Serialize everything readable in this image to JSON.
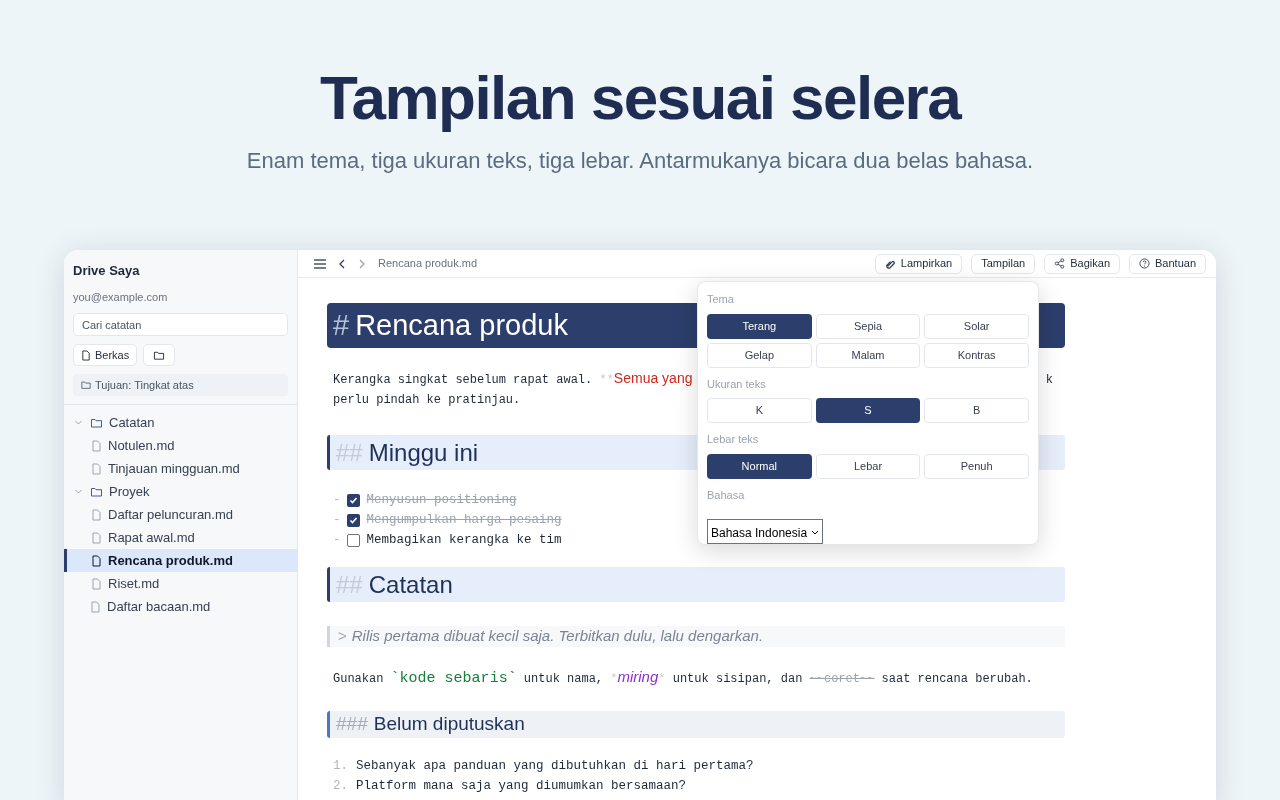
{
  "hero": {
    "title": "Tampilan sesuai selera",
    "subtitle": "Enam tema, tiga ukuran teks, tiga lebar. Antarmukanya bicara dua belas bahasa."
  },
  "sidebar": {
    "title": "Drive Saya",
    "email": "you@example.com",
    "search": {
      "placeholder": "Cari catatan"
    },
    "buttons": [
      {
        "kind": "file",
        "label": "Berkas"
      },
      {
        "kind": "folder"
      }
    ],
    "destination": "Tujuan: Tingkat atas",
    "tree": [
      {
        "kind": "folder",
        "label": "Catatan",
        "expanded": true,
        "selected": false,
        "children": [
          {
            "kind": "file",
            "label": "Notulen.md",
            "selected": false
          },
          {
            "kind": "file",
            "label": "Tinjauan mingguan.md",
            "selected": false
          }
        ]
      },
      {
        "kind": "folder",
        "label": "Proyek",
        "expanded": true,
        "selected": false,
        "children": [
          {
            "kind": "file",
            "label": "Daftar peluncuran.md",
            "selected": false
          },
          {
            "kind": "file",
            "label": "Rapat awal.md",
            "selected": false
          },
          {
            "kind": "file",
            "label": "Rencana produk.md",
            "selected": true
          },
          {
            "kind": "file",
            "label": "Riset.md",
            "selected": false
          }
        ]
      },
      {
        "kind": "file",
        "label": "Daftar bacaan.md",
        "selected": false
      }
    ]
  },
  "toolbar": {
    "path": "Rencana produk.md",
    "buttons": [
      {
        "kind": "attach",
        "label": "Lampirkan"
      },
      {
        "kind": "plain",
        "label": "Tampilan"
      },
      {
        "kind": "share",
        "label": "Bagikan"
      },
      {
        "kind": "help",
        "label": "Bantuan"
      }
    ]
  },
  "editor": {
    "blocks": [
      {
        "kind": "h1",
        "marker": "#",
        "text": "Rencana produk"
      },
      {
        "kind": "paragraph",
        "lines": [
          {
            "segments": [
              {
                "kind": "text",
                "text": "Kerangka singkat sebelum rapat awal. "
              },
              {
                "kind": "mark",
                "text": "**"
              },
              {
                "kind": "strong",
                "text": "Semua yang"
              }
            ],
            "tail": "k"
          },
          {
            "segments": [
              {
                "kind": "text",
                "text": "perlu pindah ke pratinjau."
              }
            ]
          }
        ]
      },
      {
        "kind": "h2",
        "marker": "##",
        "text": "Minggu ini"
      },
      {
        "kind": "task",
        "marker": "-",
        "checked": true,
        "text": "Menyusun positioning"
      },
      {
        "kind": "task",
        "marker": "-",
        "checked": true,
        "text": "Mengumpulkan harga pesaing"
      },
      {
        "kind": "task",
        "marker": "-",
        "checked": false,
        "text": "Membagikan kerangka ke tim"
      },
      {
        "kind": "h2",
        "marker": "##",
        "text": "Catatan"
      },
      {
        "kind": "quote",
        "marker": ">",
        "text": "Rilis pertama dibuat kecil saja. Terbitkan dulu, lalu dengarkan."
      },
      {
        "kind": "paragraph",
        "lines": [
          {
            "segments": [
              {
                "kind": "text",
                "text": "Gunakan "
              },
              {
                "kind": "code",
                "text": "`kode sebaris`"
              },
              {
                "kind": "text",
                "text": " untuk nama, "
              },
              {
                "kind": "mark",
                "text": "*"
              },
              {
                "kind": "italic",
                "text": "miring"
              },
              {
                "kind": "mark",
                "text": "*"
              },
              {
                "kind": "text",
                "text": " untuk sisipan, dan "
              },
              {
                "kind": "strike",
                "text": "~~coret~~"
              },
              {
                "kind": "text",
                "text": " saat rencana berubah."
              }
            ]
          }
        ]
      },
      {
        "kind": "h3",
        "marker": "###",
        "text": "Belum diputuskan"
      },
      {
        "kind": "ordered",
        "items": [
          {
            "number": "1.",
            "text": "Sebanyak apa panduan yang dibutuhkan di hari pertama?"
          },
          {
            "number": "2.",
            "text": "Platform mana saja yang diumumkan bersamaan?"
          }
        ]
      }
    ]
  },
  "popover": {
    "sections": [
      {
        "label": "Tema",
        "options": [
          {
            "label": "Terang",
            "selected": true
          },
          {
            "label": "Sepia",
            "selected": false
          },
          {
            "label": "Solar",
            "selected": false
          },
          {
            "label": "Gelap",
            "selected": false
          },
          {
            "label": "Malam",
            "selected": false
          },
          {
            "label": "Kontras",
            "selected": false
          }
        ]
      },
      {
        "label": "Ukuran teks",
        "options": [
          {
            "label": "K",
            "selected": false
          },
          {
            "label": "S",
            "selected": true
          },
          {
            "label": "B",
            "selected": false
          }
        ]
      },
      {
        "label": "Lebar teks",
        "options": [
          {
            "label": "Normal",
            "selected": true
          },
          {
            "label": "Lebar",
            "selected": false
          },
          {
            "label": "Penuh",
            "selected": false
          }
        ]
      },
      {
        "label": "Bahasa",
        "select": {
          "value": "Bahasa Indonesia"
        }
      }
    ]
  }
}
